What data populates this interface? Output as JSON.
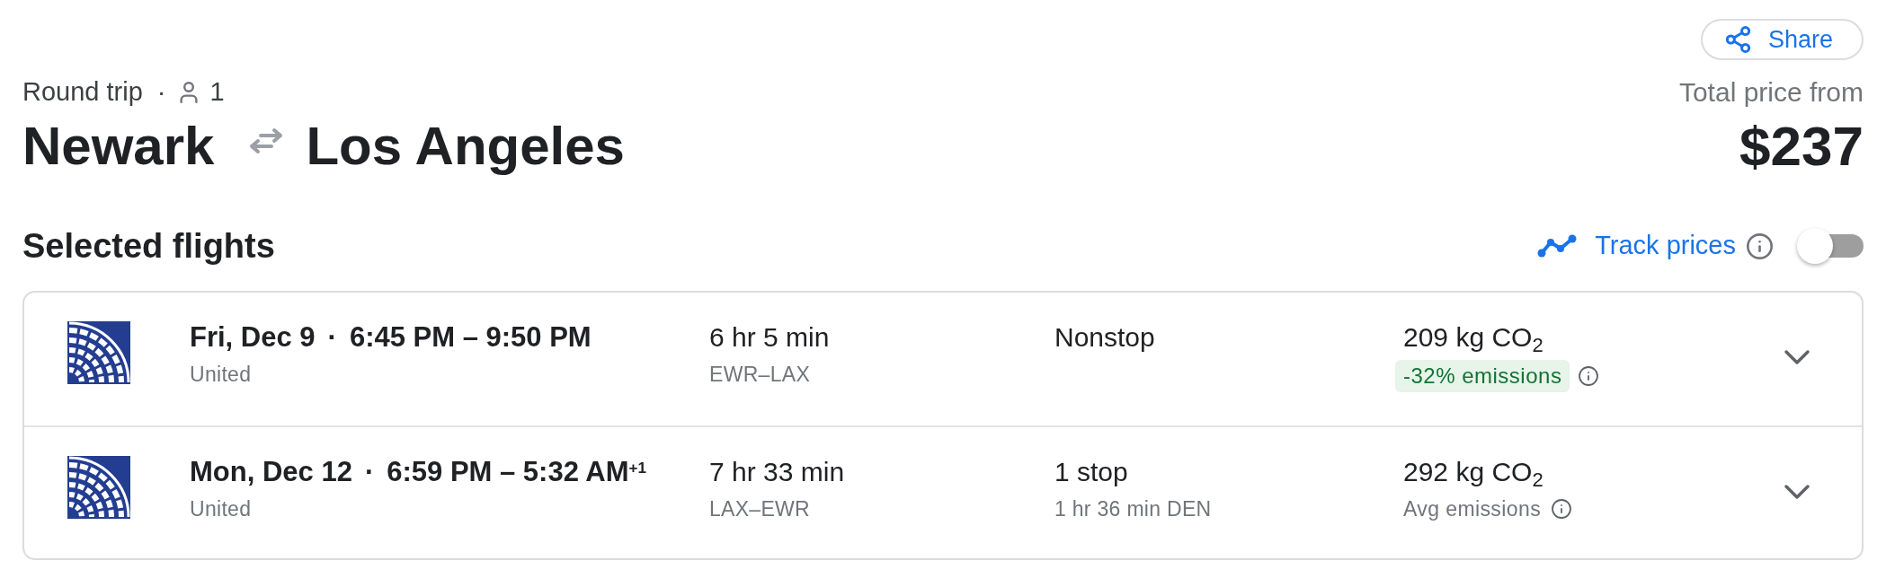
{
  "share_button": {
    "label": "Share"
  },
  "trip": {
    "type": "Round trip",
    "separator": "·",
    "passengers": "1"
  },
  "route": {
    "origin": "Newark",
    "destination": "Los Angeles"
  },
  "price": {
    "label": "Total price from",
    "amount": "$237"
  },
  "selected_flights": {
    "title": "Selected flights",
    "track_prices": {
      "label": "Track prices",
      "on": false
    }
  },
  "flights": [
    {
      "date": "Fri, Dec 9",
      "separator": "·",
      "times": "6:45 PM – 9:50 PM",
      "airline": "United",
      "duration": "6 hr 5 min",
      "airports": "EWR–LAX",
      "stops": "Nonstop",
      "emissions": "209 kg CO$_{2}$",
      "emissions_note": {
        "kind": "badge",
        "text": "-32% emissions"
      },
      "expanded": false
    },
    {
      "date": "Mon, Dec 12",
      "separator": "·",
      "times": "6:59 PM – 5:32 AM$^{+1}$",
      "airline": "United",
      "duration": "7 hr 33 min",
      "airports": "LAX–EWR",
      "stops": "1 stop",
      "layover": "1 hr 36 min DEN",
      "emissions": "292 kg CO$_{2}$",
      "emissions_note": {
        "kind": "plain",
        "text": "Avg emissions"
      },
      "expanded": false
    }
  ]
}
